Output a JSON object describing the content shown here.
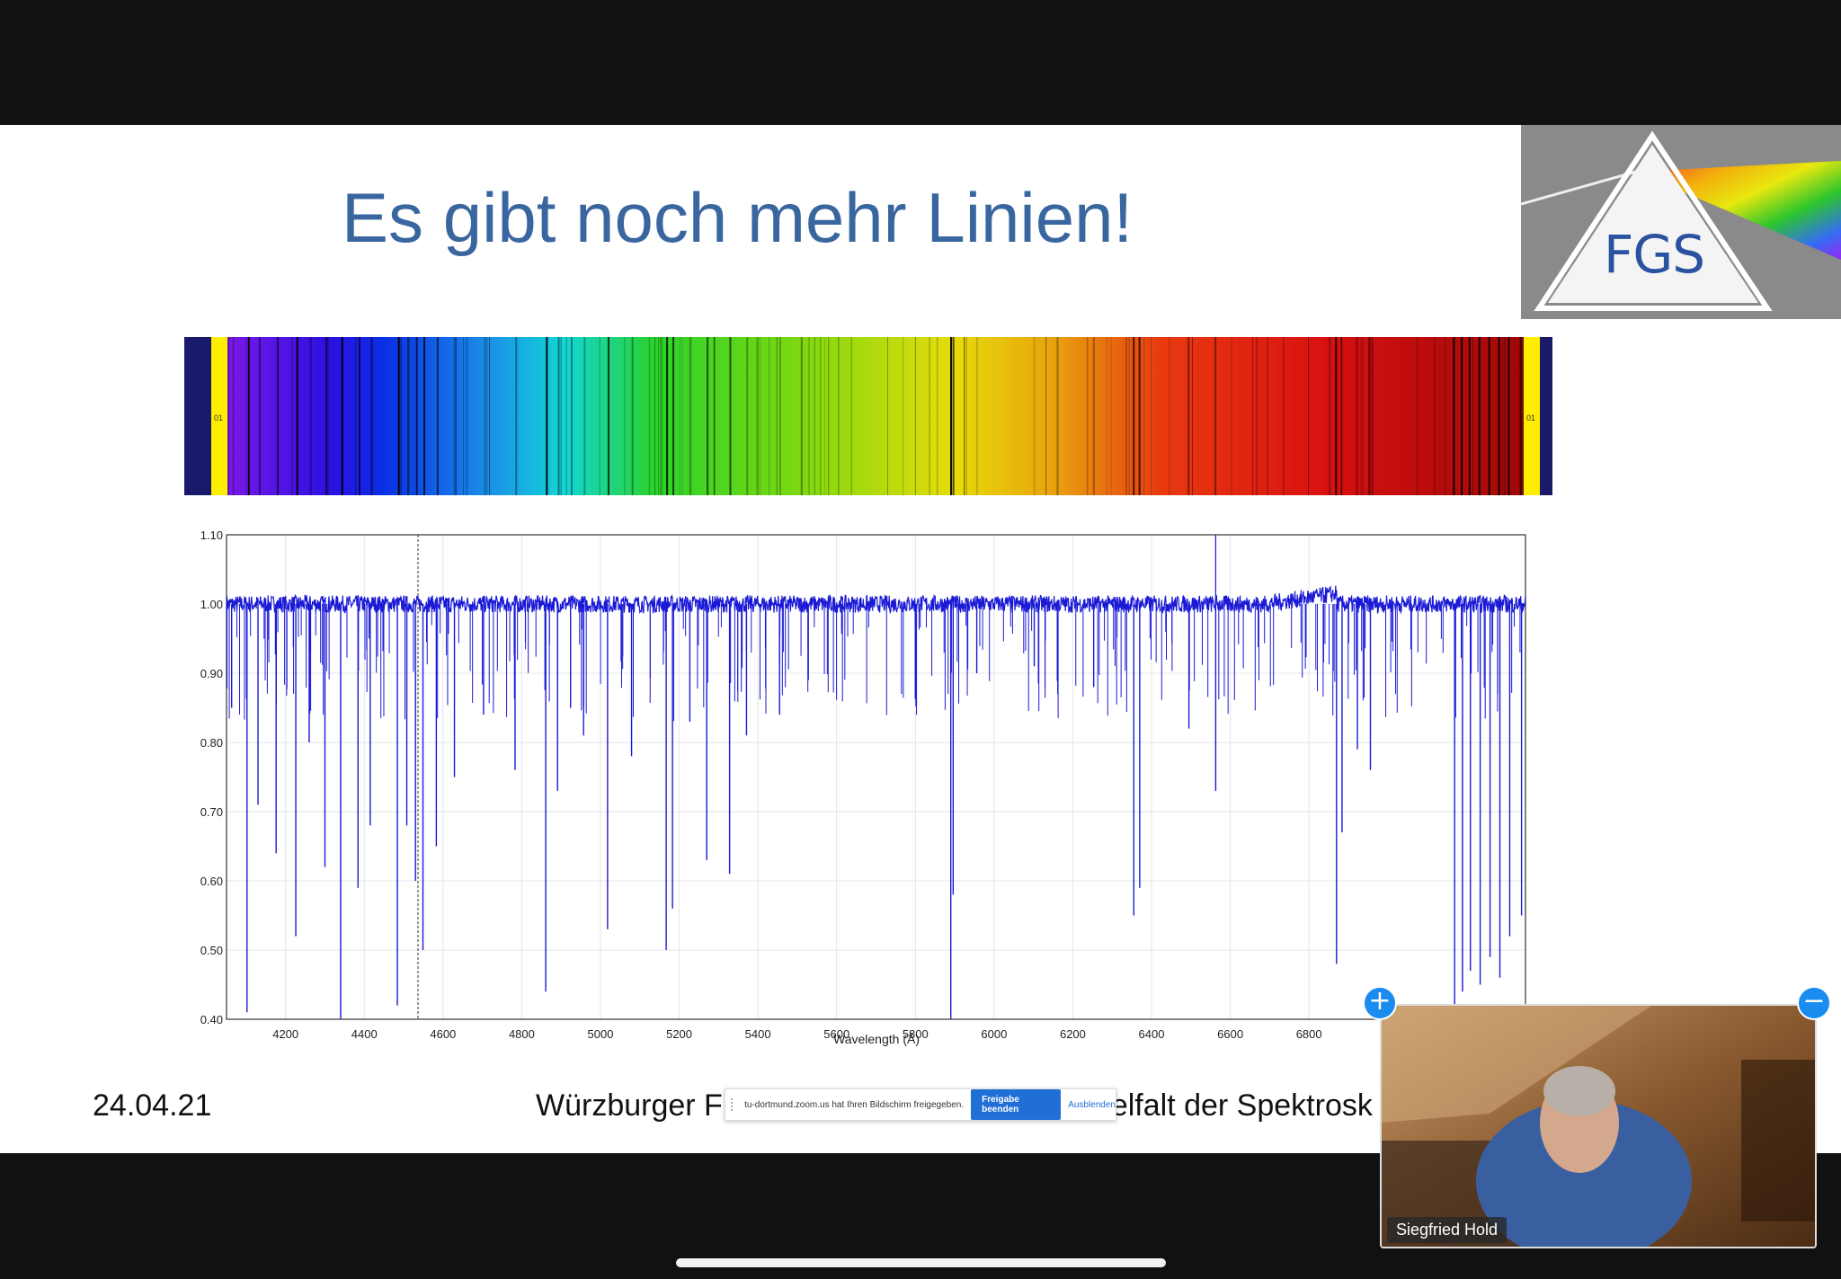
{
  "slide": {
    "title": "Es gibt noch mehr Linien!",
    "date": "24.04.21",
    "footer_text": "Würzburger F",
    "footer_text_right": "elfalt der Spektrosk",
    "logo_text": "FGS",
    "strip_label": "01"
  },
  "chart_data": {
    "type": "line",
    "xlabel": "Wavelength (Å)",
    "ylabel": "",
    "xlim": [
      4050,
      7350
    ],
    "ylim": [
      0.4,
      1.1
    ],
    "x_ticks": [
      "4200",
      "4400",
      "4600",
      "4800",
      "5000",
      "5200",
      "5400",
      "5600",
      "5800",
      "6000",
      "6200",
      "6400",
      "6600",
      "6800"
    ],
    "y_ticks": [
      "0.40",
      "0.50",
      "0.60",
      "0.70",
      "0.80",
      "0.90",
      "1.00",
      "1.10"
    ],
    "grid": true,
    "series_color": "#1a1ad6",
    "absorption_lines": [
      {
        "x": 4063,
        "y": 0.85
      },
      {
        "x": 4102,
        "y": 0.41
      },
      {
        "x": 4130,
        "y": 0.71
      },
      {
        "x": 4176,
        "y": 0.64
      },
      {
        "x": 4226,
        "y": 0.52
      },
      {
        "x": 4260,
        "y": 0.8
      },
      {
        "x": 4300,
        "y": 0.62
      },
      {
        "x": 4340,
        "y": 0.4
      },
      {
        "x": 4384,
        "y": 0.59
      },
      {
        "x": 4415,
        "y": 0.68
      },
      {
        "x": 4484,
        "y": 0.42
      },
      {
        "x": 4508,
        "y": 0.68
      },
      {
        "x": 4530,
        "y": 0.6
      },
      {
        "x": 4549,
        "y": 0.5
      },
      {
        "x": 4583,
        "y": 0.65
      },
      {
        "x": 4629,
        "y": 0.75
      },
      {
        "x": 4703,
        "y": 0.84
      },
      {
        "x": 4783,
        "y": 0.76
      },
      {
        "x": 4861,
        "y": 0.44
      },
      {
        "x": 4891,
        "y": 0.73
      },
      {
        "x": 4924,
        "y": 0.85
      },
      {
        "x": 4957,
        "y": 0.81
      },
      {
        "x": 5018,
        "y": 0.53
      },
      {
        "x": 5079,
        "y": 0.78
      },
      {
        "x": 5167,
        "y": 0.5
      },
      {
        "x": 5183,
        "y": 0.56
      },
      {
        "x": 5227,
        "y": 0.83
      },
      {
        "x": 5270,
        "y": 0.63
      },
      {
        "x": 5328,
        "y": 0.61
      },
      {
        "x": 5371,
        "y": 0.81
      },
      {
        "x": 5455,
        "y": 0.84
      },
      {
        "x": 5528,
        "y": 0.89
      },
      {
        "x": 5890,
        "y": 0.4
      },
      {
        "x": 5896,
        "y": 0.58
      },
      {
        "x": 5956,
        "y": 0.9
      },
      {
        "x": 6102,
        "y": 0.91
      },
      {
        "x": 6162,
        "y": 0.87
      },
      {
        "x": 6253,
        "y": 0.88
      },
      {
        "x": 6355,
        "y": 0.55
      },
      {
        "x": 6370,
        "y": 0.59
      },
      {
        "x": 6495,
        "y": 0.82
      },
      {
        "x": 6563,
        "y": 0.73
      },
      {
        "x": 6870,
        "y": 0.48
      },
      {
        "x": 6884,
        "y": 0.67
      },
      {
        "x": 6923,
        "y": 0.79
      },
      {
        "x": 6956,
        "y": 0.76
      },
      {
        "x": 7170,
        "y": 0.42
      },
      {
        "x": 7190,
        "y": 0.44
      },
      {
        "x": 7210,
        "y": 0.47
      },
      {
        "x": 7235,
        "y": 0.45
      },
      {
        "x": 7260,
        "y": 0.49
      },
      {
        "x": 7285,
        "y": 0.46
      },
      {
        "x": 7310,
        "y": 0.52
      },
      {
        "x": 7340,
        "y": 0.55
      }
    ]
  },
  "share_banner": {
    "message": "tu-dortmund.zoom.us hat Ihren Bildschirm freigegeben.",
    "stop_label": "Freigabe beenden",
    "hide_label": "Ausblenden"
  },
  "video": {
    "participant_name": "Siegfried Hold",
    "plus_icon": "+",
    "minus_icon": "−"
  }
}
